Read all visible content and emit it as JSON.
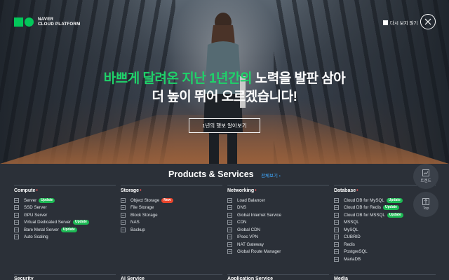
{
  "brand": {
    "line1": "NAVER",
    "line2": "CLOUD PLATFORM"
  },
  "popup": {
    "dont_show": "다시 보지 않기",
    "close_icon": "close-icon"
  },
  "hero": {
    "headline_green": "바쁘게 달려온 지난 1년간의",
    "headline_white1": " 노력을 발판 삼아",
    "headline_line2": "더 높이 뛰어 오르겠습니다!",
    "cta": "1년의 행보 알아보기"
  },
  "products": {
    "title": "Products & Services",
    "view_all": "전체보기 ›",
    "columns": [
      {
        "name": "Compute",
        "items": [
          {
            "label": "Server",
            "badge": "Update"
          },
          {
            "label": "SSD Server",
            "badge": ""
          },
          {
            "label": "GPU Server",
            "badge": ""
          },
          {
            "label": "Virtual Dedicated Server",
            "badge": "Update"
          },
          {
            "label": "Bare Metal Server",
            "badge": "Update"
          },
          {
            "label": "Auto Scaling",
            "badge": ""
          }
        ]
      },
      {
        "name": "Storage",
        "items": [
          {
            "label": "Object Storage",
            "badge": "New"
          },
          {
            "label": "File Storage",
            "badge": ""
          },
          {
            "label": "Block Storage",
            "badge": ""
          },
          {
            "label": "NAS",
            "badge": ""
          },
          {
            "label": "Backup",
            "badge": ""
          }
        ]
      },
      {
        "name": "Networking",
        "items": [
          {
            "label": "Load Balancer",
            "badge": ""
          },
          {
            "label": "DNS",
            "badge": ""
          },
          {
            "label": "Global Internet Service",
            "badge": ""
          },
          {
            "label": "CDN",
            "badge": ""
          },
          {
            "label": "Global CDN",
            "badge": ""
          },
          {
            "label": "IPsec VPN",
            "badge": ""
          },
          {
            "label": "NAT Gateway",
            "badge": ""
          },
          {
            "label": "Global Route Manager",
            "badge": ""
          }
        ]
      },
      {
        "name": "Database",
        "items": [
          {
            "label": "Cloud DB for MySQL",
            "badge": "Update"
          },
          {
            "label": "Cloud DB for Redis",
            "badge": "Update"
          },
          {
            "label": "Cloud DB for MSSQL",
            "badge": "Update"
          },
          {
            "label": "MSSQL",
            "badge": ""
          },
          {
            "label": "MySQL",
            "badge": ""
          },
          {
            "label": "CUBRID",
            "badge": ""
          },
          {
            "label": "Redis",
            "badge": ""
          },
          {
            "label": "PostgreSQL",
            "badge": ""
          },
          {
            "label": "MariaDB",
            "badge": ""
          }
        ]
      }
    ],
    "row2": [
      "Security",
      "AI Service",
      "Application Service",
      "Media"
    ]
  },
  "floating": {
    "trend_label": "트렌드",
    "top_label": "Top"
  },
  "colors": {
    "brand_green": "#03c75a",
    "headline_green": "#1fd26a",
    "update_badge": "#1db954",
    "new_badge": "#e8452c",
    "link_blue": "#3fa9ff"
  }
}
